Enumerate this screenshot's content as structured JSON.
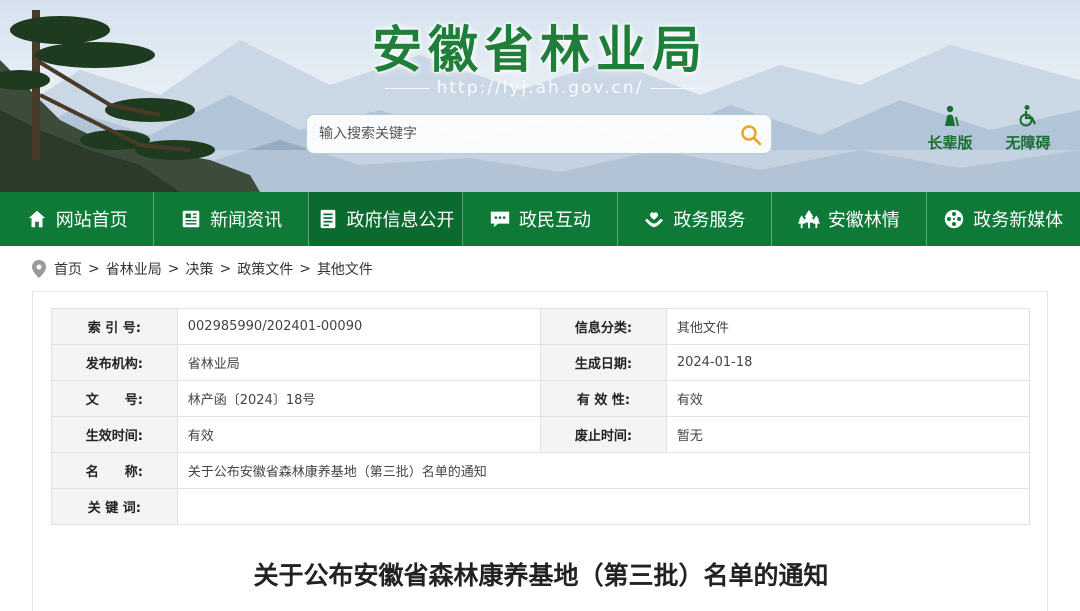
{
  "banner": {
    "title": "安徽省林业局",
    "url": "http://lyj.ah.gov.cn/",
    "search_placeholder": "输入搜索关键字",
    "modes": [
      {
        "label": "长辈版",
        "icon": "elderly-person-icon"
      },
      {
        "label": "无障碍",
        "icon": "wheelchair-icon"
      }
    ]
  },
  "nav": {
    "items": [
      {
        "label": "网站首页",
        "icon": "home-icon"
      },
      {
        "label": "新闻资讯",
        "icon": "newspaper-icon"
      },
      {
        "label": "政府信息公开",
        "icon": "document-list-icon",
        "active": true
      },
      {
        "label": "政民互动",
        "icon": "chat-bubble-icon"
      },
      {
        "label": "政务服务",
        "icon": "heart-hands-icon"
      },
      {
        "label": "安徽林情",
        "icon": "trees-icon"
      },
      {
        "label": "政务新媒体",
        "icon": "film-reel-icon"
      }
    ]
  },
  "breadcrumb": {
    "items": [
      "首页",
      "省林业局",
      "决策",
      "政策文件",
      "其他文件"
    ],
    "separator": ">"
  },
  "meta_table": {
    "rows": [
      {
        "k1": "索 引 号:",
        "v1": "002985990/202401-00090",
        "k2": "信息分类:",
        "v2": "其他文件"
      },
      {
        "k1": "发布机构:",
        "v1": "省林业局",
        "k2": "生成日期:",
        "v2": "2024-01-18"
      },
      {
        "k1": "文　　号:",
        "v1": "林产函〔2024〕18号",
        "k2": "有 效 性:",
        "v2": "有效"
      },
      {
        "k1": "生效时间:",
        "v1": "有效",
        "k2": "废止时间:",
        "v2": "暂无"
      },
      {
        "k1": "名　　称:",
        "v1": "关于公布安徽省森林康养基地（第三批）名单的通知"
      },
      {
        "k1": "关 键 词:",
        "v1": ""
      }
    ]
  },
  "document": {
    "title": "关于公布安徽省森林康养基地（第三批）名单的通知"
  },
  "colors": {
    "brand_green": "#0f7a37",
    "title_green": "#1f7f3a"
  }
}
